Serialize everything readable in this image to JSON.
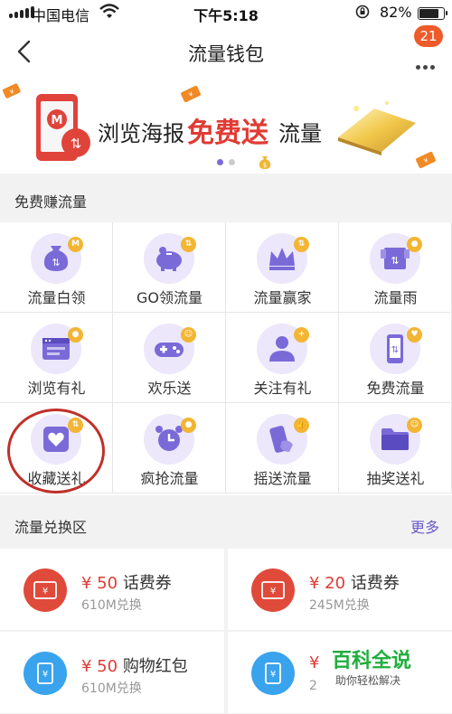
{
  "status": {
    "carrier": "中国电信",
    "time": "下午5:18",
    "battery_pct": "82%",
    "battery_level": 0.82
  },
  "nav": {
    "title": "流量钱包",
    "badge": "21"
  },
  "banner": {
    "text_left": "浏览海报",
    "text_highlight": "免费送",
    "text_right": "流量",
    "page_indicator": {
      "count": 2,
      "active": 0
    }
  },
  "earn": {
    "header": "免费赚流量",
    "items": [
      {
        "label": "流量白领",
        "icon": "money-bag-icon",
        "mini": "M"
      },
      {
        "label": "GO领流量",
        "icon": "piggy-bank-icon",
        "mini": "⇅"
      },
      {
        "label": "流量赢家",
        "icon": "crown-icon",
        "mini": "⇅"
      },
      {
        "label": "流量雨",
        "icon": "gift-box-icon",
        "mini": "●"
      },
      {
        "label": "浏览有礼",
        "icon": "browser-window-icon",
        "mini": "●"
      },
      {
        "label": "欢乐送",
        "icon": "gamepad-icon",
        "mini": "☺"
      },
      {
        "label": "关注有礼",
        "icon": "user-icon",
        "mini": "+"
      },
      {
        "label": "免费流量",
        "icon": "phone-icon",
        "mini": "♥"
      },
      {
        "label": "收藏送礼",
        "icon": "heart-card-icon",
        "mini": "⇅"
      },
      {
        "label": "疯抢流量",
        "icon": "alarm-clock-icon",
        "mini": "●"
      },
      {
        "label": "摇送流量",
        "icon": "shake-phone-icon",
        "mini": "👍"
      },
      {
        "label": "抽奖送礼",
        "icon": "folder-icon",
        "mini": "☺"
      }
    ]
  },
  "exchange": {
    "header": "流量兑换区",
    "more": "更多",
    "items": [
      {
        "price": "¥ 50",
        "name": "话费券",
        "sub": "610M兑换",
        "icon": "ticket-icon",
        "color": "#e04a3a"
      },
      {
        "price": "¥ 20",
        "name": "话费券",
        "sub": "245M兑换",
        "icon": "ticket-icon",
        "color": "#e04a3a"
      },
      {
        "price": "¥ 50",
        "name": "购物红包",
        "sub": "610M兑换",
        "icon": "coupon-card-icon",
        "color": "#3aa3ee"
      },
      {
        "price": "¥",
        "name": "",
        "sub": "2",
        "icon": "coupon-card-icon",
        "color": "#3aa3ee"
      }
    ]
  },
  "watermark": {
    "main": "百科全说",
    "sub": "助你轻松解决"
  },
  "colors": {
    "accent": "#6a5acd",
    "red": "#e03b34",
    "badge": "#ee5b2a",
    "icon_bg": "#ece7fb",
    "purple": "#7a6ad8"
  }
}
